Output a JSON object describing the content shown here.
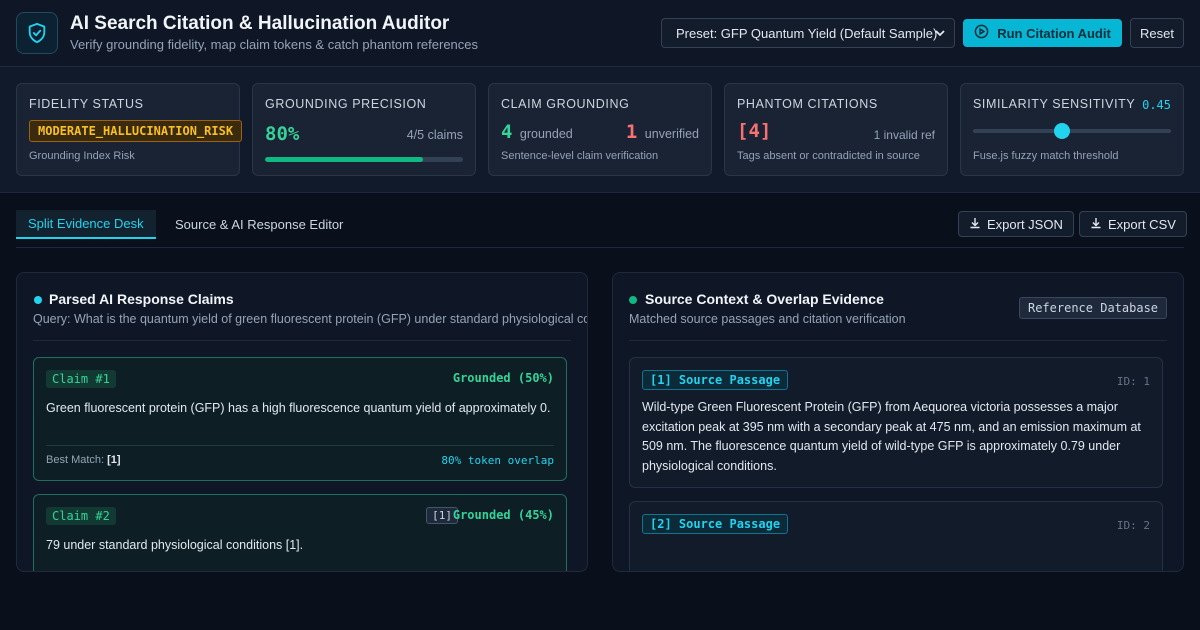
{
  "header": {
    "title": "AI Search Citation & Hallucination Auditor",
    "subtitle": "Verify grounding fidelity, map claim tokens & catch phantom references",
    "preset_label": "Preset: GFP Quantum Yield (Default Sample)",
    "run_label": "Run Citation Audit",
    "reset_label": "Reset"
  },
  "metrics": {
    "fidelity": {
      "label": "FIDELITY STATUS",
      "badge": "MODERATE_HALLUCINATION_RISK",
      "foot": "Grounding Index Risk"
    },
    "precision": {
      "label": "GROUNDING PRECISION",
      "value": "80%",
      "claims": "4/5 claims",
      "progress": 0.8
    },
    "grounding": {
      "label": "CLAIM GROUNDING",
      "grounded_count": "4",
      "grounded_label": "grounded",
      "unverified_count": "1",
      "unverified_label": "unverified",
      "foot": "Sentence-level claim verification"
    },
    "phantom": {
      "label": "PHANTOM CITATIONS",
      "value": "[4]",
      "invalid": "1 invalid ref",
      "foot": "Tags absent or contradicted in source"
    },
    "sensitivity": {
      "label": "SIMILARITY SENSITIVITY",
      "value": "0.45",
      "level": 0.45,
      "foot": "Fuse.js fuzzy match threshold"
    }
  },
  "tabs": {
    "active": "Split Evidence Desk",
    "inactive": "Source & AI Response Editor",
    "export_json": "Export JSON",
    "export_csv": "Export CSV"
  },
  "claims_panel": {
    "title": "Parsed AI Response Claims",
    "query": "Query: What is the quantum yield of green fluorescent protein (GFP) under standard physiological conditions?",
    "claims": [
      {
        "badge": "Claim #1",
        "status": "Grounded (50%)",
        "text": "Green fluorescent protein (GFP) has a high fluorescence quantum yield of approximately 0.",
        "match_label": "Best Match:",
        "match_ref": "[1]",
        "overlap": "80% token overlap"
      },
      {
        "badge": "Claim #2",
        "cite": "[1]",
        "status": "Grounded (45%)",
        "text": "79 under standard physiological conditions [1]."
      }
    ]
  },
  "source_panel": {
    "title": "Source Context & Overlap Evidence",
    "subtitle": "Matched source passages and citation verification",
    "ref_label": "Reference Database",
    "sources": [
      {
        "badge": "[1] Source Passage",
        "id": "ID: 1",
        "text": "Wild-type Green Fluorescent Protein (GFP) from Aequorea victoria possesses a major excitation peak at 395 nm with a secondary peak at 475 nm, and an emission maximum at 509 nm. The fluorescence quantum yield of wild-type GFP is approximately 0.79 under physiological conditions."
      },
      {
        "badge": "[2] Source Passage",
        "id": "ID: 2",
        "text": ""
      }
    ]
  },
  "colors": {
    "accent": "#06b6d4",
    "success": "#34d399",
    "danger": "#f87171",
    "warning": "#fbbf24"
  }
}
